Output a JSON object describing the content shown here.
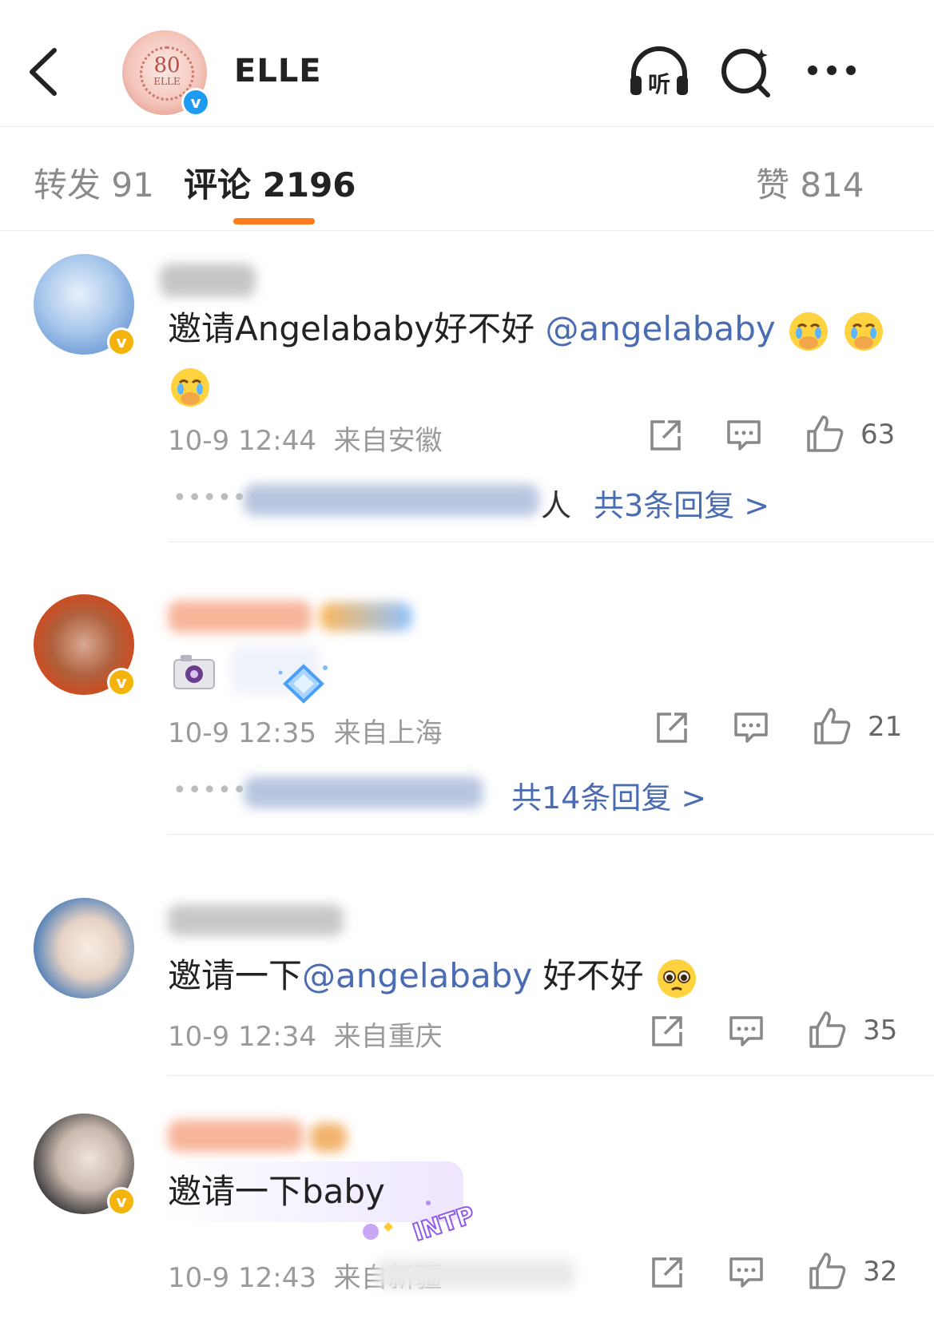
{
  "header": {
    "account_name": "ELLE",
    "avatar_text": "80",
    "avatar_sub": "ELLE",
    "verified_mark": "v",
    "listen_label": "听"
  },
  "tabs": {
    "repost": "转发 91",
    "comments": "评论 2196",
    "likes": "赞 814"
  },
  "comments": [
    {
      "text_before": "邀请Angelababy好不好 ",
      "mention": "@angelababy",
      "emojis": [
        "crying-face",
        "crying-face",
        "crying-face"
      ],
      "time": "10-9 12:44",
      "location": "来自安徽",
      "likes": "63",
      "reply_tail": "人",
      "reply_link": "共3条回复 >"
    },
    {
      "time": "10-9 12:35",
      "location": "来自上海",
      "likes": "21",
      "reply_link": "共14条回复 >"
    },
    {
      "text_before": "邀请一下",
      "mention": "@angelababy",
      "text_after": " 好不好",
      "emojis": [
        "pleading-face"
      ],
      "time": "10-9 12:34",
      "location": "来自重庆",
      "likes": "35"
    },
    {
      "text_before": "邀请一下baby",
      "badge_text": "INTP",
      "time": "10-9 12:43",
      "location": "来自新疆",
      "likes": "32"
    }
  ],
  "verified_mark": "v",
  "colors": {
    "accent": "#ff7a1a",
    "mention": "#4a6cb3",
    "verified_gold": "#f5b40b",
    "verified_blue": "#1d9bf0"
  }
}
